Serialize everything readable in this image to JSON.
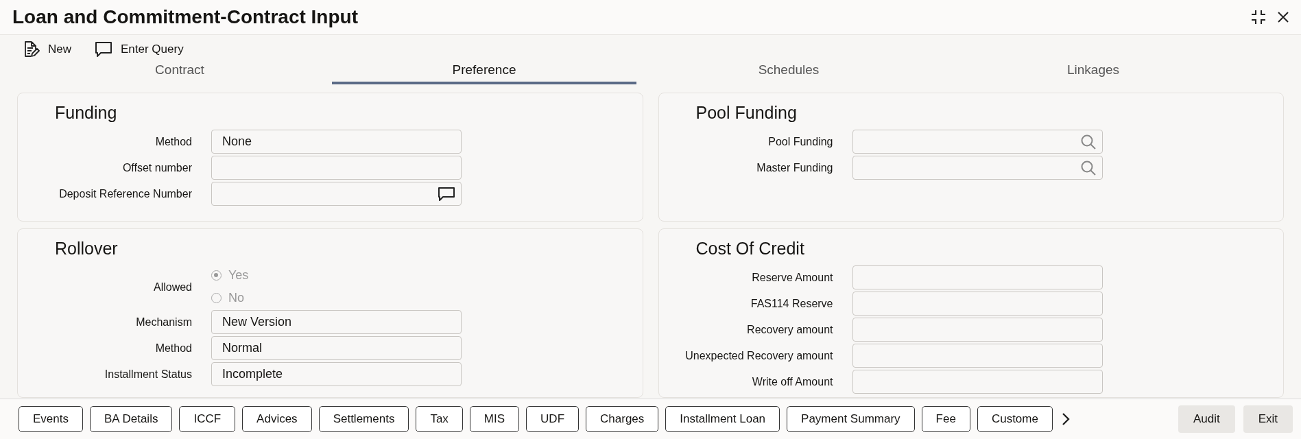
{
  "window": {
    "title": "Loan and Commitment-Contract Input"
  },
  "toolbar": [
    {
      "kind": "new",
      "label": "New"
    },
    {
      "kind": "query",
      "label": "Enter Query"
    }
  ],
  "tabs": [
    {
      "label": "Contract",
      "selected": false
    },
    {
      "label": "Preference",
      "selected": true
    },
    {
      "label": "Schedules",
      "selected": false
    },
    {
      "label": "Linkages",
      "selected": false
    }
  ],
  "left_panels": [
    {
      "title": "Funding",
      "rows": [
        {
          "kind": "text",
          "label": "Method",
          "value": "None"
        },
        {
          "kind": "text",
          "label": "Offset number"
        },
        {
          "kind": "comment",
          "label": "Deposit Reference Number"
        }
      ]
    },
    {
      "title": "Rollover",
      "rows": [
        {
          "kind": "radio",
          "label": "Allowed",
          "disabled": true,
          "options": [
            {
              "label": "Yes",
              "selected": true
            },
            {
              "label": "No",
              "selected": false
            }
          ]
        },
        {
          "kind": "text",
          "label": "Mechanism",
          "value": "New Version"
        },
        {
          "kind": "text",
          "label": "Method",
          "value": "Normal"
        },
        {
          "kind": "text",
          "label": "Installment Status",
          "value": "Incomplete"
        }
      ]
    }
  ],
  "right_panels": [
    {
      "title": "Pool Funding",
      "rows": [
        {
          "kind": "search",
          "label": "Pool Funding"
        },
        {
          "kind": "search",
          "label": "Master Funding"
        }
      ]
    },
    {
      "title": "Cost Of Credit",
      "rows": [
        {
          "kind": "text",
          "label": "Reserve Amount"
        },
        {
          "kind": "text",
          "label": "FAS114 Reserve"
        },
        {
          "kind": "text",
          "label": "Recovery amount"
        },
        {
          "kind": "text",
          "label": "Unexpected Recovery amount"
        },
        {
          "kind": "text",
          "label": "Write off Amount"
        }
      ]
    }
  ],
  "footer_buttons": [
    "Events",
    "BA Details",
    "ICCF",
    "Advices",
    "Settlements",
    "Tax",
    "MIS",
    "UDF",
    "Charges",
    "Installment Loan",
    "Payment Summary",
    "Fee",
    "Custome"
  ],
  "footer_actions": [
    "Audit",
    "Exit"
  ]
}
